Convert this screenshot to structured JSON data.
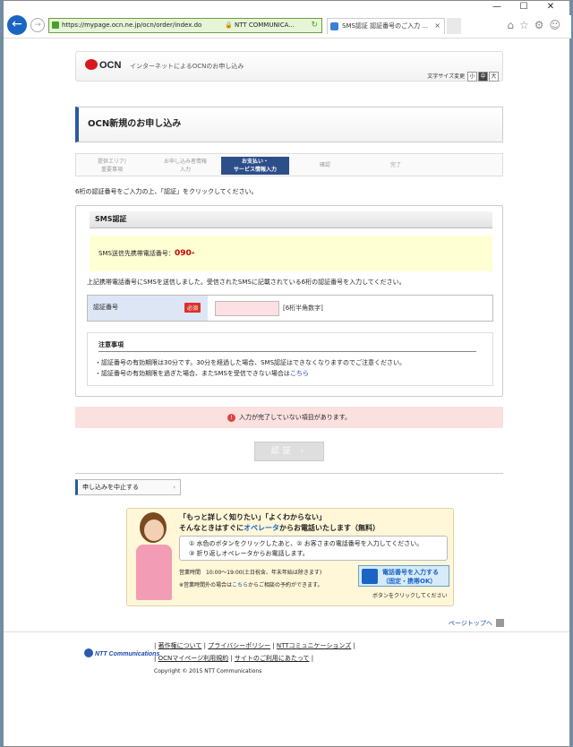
{
  "browser": {
    "url": "https://mypage.ocn.ne.jp/ocn/order/index.do",
    "cert_owner": "NTT COMMUNICA...",
    "tab_title": "SMS認証 認証番号のご入力 ...",
    "tab_close": "×",
    "window_controls": [
      "—",
      "☐",
      "✕"
    ],
    "right_icons": "⌂☆⚙☺"
  },
  "header": {
    "logo_text": "OCN",
    "tagline": "インターネットによるOCNのお申し込み",
    "font_size_label": "文字サイズ変更",
    "font_sizes": [
      "小",
      "中",
      "大"
    ]
  },
  "page_title": "OCN新規のお申し込み",
  "steps": [
    {
      "line1": "提供エリア/",
      "line2": "重要事項"
    },
    {
      "line1": "お申し込み者情報",
      "line2": "入力"
    },
    {
      "line1": "お支払い・",
      "line2": "サービス情報入力"
    },
    {
      "line1": "確認",
      "line2": ""
    },
    {
      "line1": "完了",
      "line2": ""
    }
  ],
  "instruction": "6桁の認証番号をご入力の上、「認証」をクリックしてください。",
  "sms": {
    "heading": "SMS認証",
    "phone_label": "SMS送信先携帯電話番号：",
    "phone_value": "090-",
    "sent_message": "上記携帯電話番号にSMSを送信しました。受信されたSMSに記載されている6桁の認証番号を入力してください。",
    "code_label": "認証番号",
    "required_badge": "必須",
    "code_value": "",
    "code_hint": "[6桁半角数字]"
  },
  "notes": {
    "title": "注意事項",
    "line1": "・認証番号の有効期限は30分です。30分を経過した場合、SMS認証はできなくなりますのでご注意ください。",
    "line2": "・認証番号の有効期限を過ぎた場合、またSMSを受信できない場合は",
    "line2_link": "こちら"
  },
  "error": {
    "icon": "!",
    "text": "入力が完了していない項目があります。"
  },
  "submit_label": "認証",
  "cancel_label": "申し込みを中止する",
  "cancel_arrow": "›",
  "banner": {
    "line1": "「もっと詳しく知りたい」「よくわからない」",
    "line2_pre": "そんなときはすぐに",
    "line2_op": "オペレータ",
    "line2_post": "からお電話いたします（無料）",
    "step1": "① 水色のボタンをクリックしたあと、② お客さまの電話番号を入力してください。",
    "step2": "③ 折り返しオペレータからお電話します。",
    "hours": "営業時間　10:00〜19:00(土日祝含、年末年始は除きます)",
    "hours2_pre": "※営業時間外の場合は",
    "hours2_link": "こちら",
    "hours2_post": "からご相談の予約ができます。",
    "call_line1": "電話番号を入力する",
    "call_line2": "（固定・携帯OK）",
    "call_tip": "ボタンをクリックしてください"
  },
  "page_top": "ページトップへ",
  "footer": {
    "ntt_logo": "NTT Communications",
    "links_row1": [
      "著作権について",
      "プライバシーポリシー",
      "NTTコミュニケーションズ"
    ],
    "links_row2": [
      "OCNマイページ利用規約",
      "サイトのご利用にあたって"
    ],
    "copyright": "Copyright © 2015  NTT Communications"
  }
}
